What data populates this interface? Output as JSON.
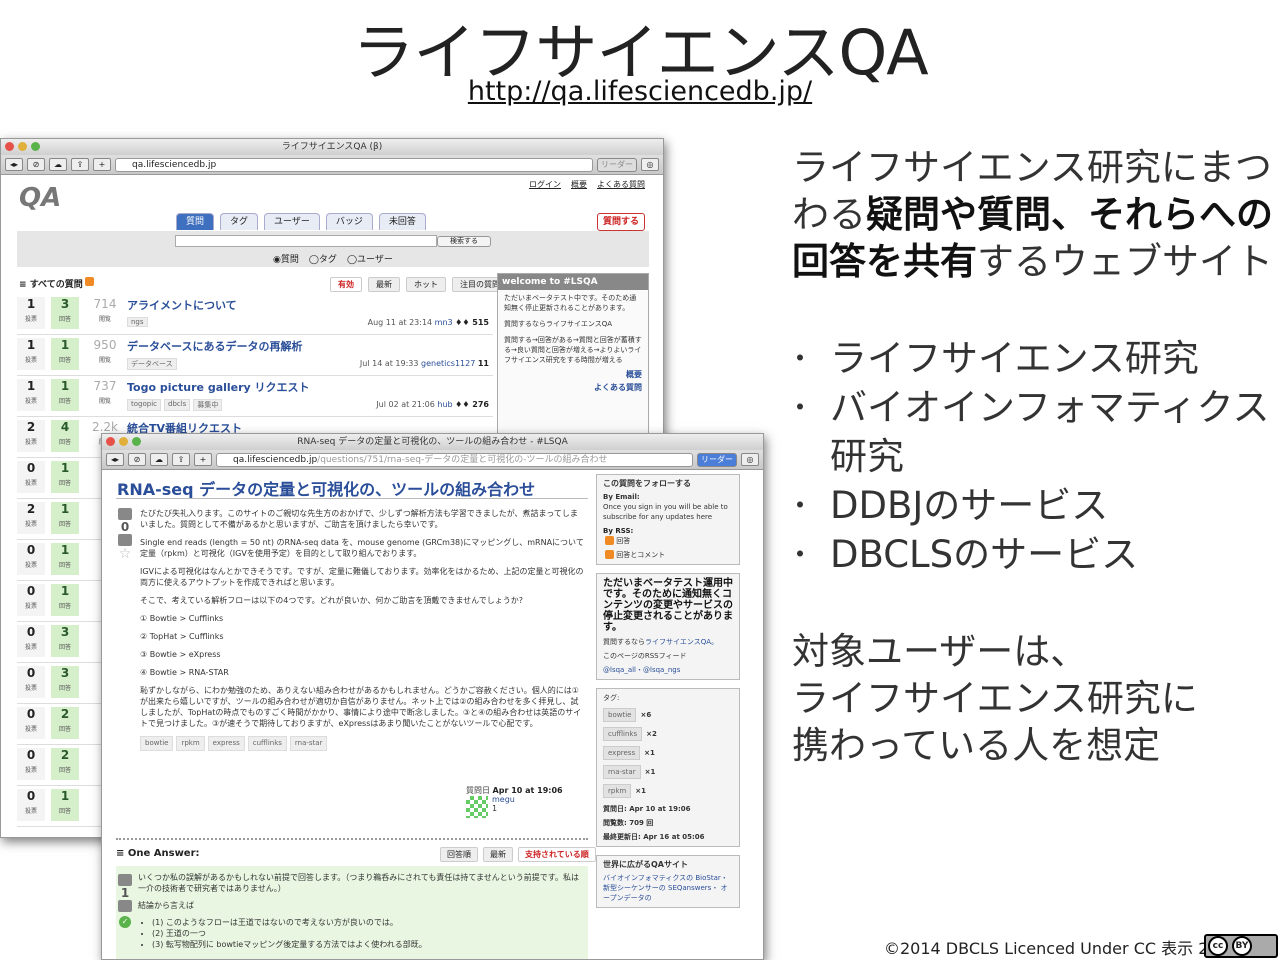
{
  "slide": {
    "title": "ライフサイエンスQA",
    "url": "http://qa.lifesciencedb.jp/",
    "desc_line1": "ライフサイエンス研究にまつ",
    "desc_line2a": "わる",
    "desc_line2b": "疑問や質問、それらへの",
    "desc_line3a": "回答を共有",
    "desc_line3b": "するウェブサイト",
    "bullets": [
      "ライフサイエンス研究",
      "バイオインフォマティクス",
      "研究",
      "DDBJのサービス",
      "DBCLSのサービス"
    ],
    "target_line1": "対象ユーザーは、",
    "target_line2": "ライフサイエンス研究に",
    "target_line3": "携わっている人を想定",
    "footer": "©2014 DBCLS Licenced Under CC 表示 2.1",
    "cc_badge": "cc",
    "by_badge": "BY"
  },
  "window1": {
    "title": "ライフサイエンスQA (β)",
    "address": "qa.lifesciencedb.jp",
    "reader": "リーダー",
    "top_links": [
      "ログイン",
      "概要",
      "よくある質問"
    ],
    "logo": "QA",
    "tabs": [
      "質問",
      "タグ",
      "ユーザー",
      "バッジ",
      "未回答"
    ],
    "ask_button": "質問する",
    "search_button": "検索する",
    "radios": [
      "◉質問",
      "◯タグ",
      "◯ユーザー"
    ],
    "all_questions": "すべての質問",
    "sort": [
      "有効",
      "最新",
      "ホット",
      "注目の質問"
    ],
    "vote_label": "投票",
    "answer_label": "回答",
    "view_label": "閲覧",
    "questions": [
      {
        "votes": "1",
        "answers": "3",
        "views": "714",
        "title": "アライメントについて",
        "tags": [
          "ngs"
        ],
        "meta": "Aug 11 at 23:14",
        "user": "mn3",
        "rep": "♦♦ 515"
      },
      {
        "votes": "1",
        "answers": "1",
        "views": "950",
        "title": "データベースにあるデータの再解析",
        "tags": [
          "データベース"
        ],
        "meta": "Jul 14 at 19:33",
        "user": "genetics1127",
        "rep": "11"
      },
      {
        "votes": "1",
        "answers": "1",
        "views": "737",
        "title": "Togo picture gallery リクエスト",
        "tags": [
          "togopic",
          "dbcls",
          "募集中"
        ],
        "meta": "Jul 02 at 21:06",
        "user": "hub",
        "rep": "♦♦ 276"
      },
      {
        "votes": "2",
        "answers": "4",
        "views": "2.2k",
        "title": "統合TV番組リクエスト",
        "tags": [],
        "meta": "",
        "user": "",
        "rep": ""
      },
      {
        "votes": "0",
        "answers": "1",
        "views": "",
        "title": "",
        "tags": [],
        "meta": "",
        "user": "",
        "rep": ""
      },
      {
        "votes": "2",
        "answers": "1",
        "views": "",
        "title": "",
        "tags": [],
        "meta": "",
        "user": "",
        "rep": ""
      },
      {
        "votes": "0",
        "answers": "1",
        "views": "",
        "title": "",
        "tags": [],
        "meta": "",
        "user": "",
        "rep": ""
      },
      {
        "votes": "0",
        "answers": "1",
        "views": "",
        "title": "",
        "tags": [],
        "meta": "",
        "user": "",
        "rep": ""
      },
      {
        "votes": "0",
        "answers": "3",
        "views": "",
        "title": "",
        "tags": [],
        "meta": "",
        "user": "",
        "rep": ""
      },
      {
        "votes": "0",
        "answers": "3",
        "views": "",
        "title": "",
        "tags": [],
        "meta": "",
        "user": "",
        "rep": ""
      },
      {
        "votes": "0",
        "answers": "2",
        "views": "",
        "title": "",
        "tags": [],
        "meta": "",
        "user": "",
        "rep": ""
      },
      {
        "votes": "0",
        "answers": "2",
        "views": "",
        "title": "",
        "tags": [],
        "meta": "",
        "user": "",
        "rep": ""
      },
      {
        "votes": "0",
        "answers": "1",
        "views": "",
        "title": "",
        "tags": [],
        "meta": "",
        "user": "",
        "rep": ""
      }
    ],
    "welcome_title": "welcome to #LSQA",
    "welcome_p1": "ただいまベータテスト中です。そのため通知無く停止更新されることがあります。",
    "welcome_p2": "質問するならライフサイエンスQA",
    "welcome_p3": "質問する→回答がある→質問と回答が蓄積する→良い質問と回答が増える→よりよいライフサイエンス研究をする時間が増える",
    "welcome_link1": "概要",
    "welcome_link2": "よくある質問"
  },
  "window2": {
    "title": "RNA-seq データの定量と可視化の、ツールの組み合わせ - #LSQA",
    "address_host": "qa.lifesciencedb.jp",
    "address_path": "/questions/751/rna-seq-データの定量と可視化の-ツールの組み合わせ",
    "reader": "リーダー",
    "question_title": "RNA-seq データの定量と可視化の、ツールの組み合わせ",
    "q_votes": "0",
    "p1": "たびたび失礼入ります。このサイトのご親切な先生方のおかげで、少しずつ解析方法も学習できましたが、煮詰まってしまいました。質問として不備があるかと思いますが、ご助言を頂けましたら幸いです。",
    "p2": "Single end reads (length = 50 nt) のRNA-seq data を、mouse genome (GRCm38)にマッピングし、mRNAについて定量（rpkm）と可視化（IGVを使用予定）を目的として取り組んでおります。",
    "p3": "IGVによる可視化はなんとかできそうです。ですが、定量に難儀しております。効率化をはかるため、上記の定量と可視化の両方に使えるアウトプットを作成できればと思います。",
    "p4": "そこで、考えている解析フローは以下の4つです。どれが良いか、何かご助言を頂戴できませんでしょうか?",
    "flows": [
      "① Bowtie > Cufflinks",
      "② TopHat > Cufflinks",
      "③ Bowtie > eXpress",
      "④ Bowtie > RNA-STAR"
    ],
    "p5": "恥ずかしながら、にわか勉強のため、ありえない組み合わせがあるかもしれません。どうかご容赦ください。個人的には①が出来たら嬉しいですが、ツールの組み合わせが適切か自信がありません。ネット上では②の組み合わせを多く拝見し、試しましたが、TopHatの時点でものすごく時間がかかり、事情により途中で断念しました。③と④の組み合わせは英語のサイトで見つけました。③が速そうで期待しておりますが、eXpressはあまり聞いたことがないツールで心配です。",
    "tags": [
      "bowtie",
      "rpkm",
      "express",
      "cufflinks",
      "rna-star"
    ],
    "asked_label": "質問日",
    "asked_date": "Apr 10 at 19:06",
    "asker": "megu",
    "asker_rep": "1",
    "one_answer": "One Answer:",
    "answer_sort": [
      "回答順",
      "最新",
      "支持されている順"
    ],
    "a_votes": "1",
    "a_p1": "いくつか私の誤解があるかもしれない前提で回答します。（つまり鵜呑みにされても責任は持てませんという前提です。私は一介の技術者で研究者ではありません。）",
    "a_p2": "結論から言えば",
    "a_items": [
      "(1) このようなフローは王道ではないので考えない方が良いのでは。",
      "(2) 王道の一つ",
      "(3) 転写物配列に bowtieマッピング後定量する方法ではよく使われる部既。"
    ],
    "follow_title": "この質問をフォローする",
    "by_email": "By Email:",
    "email_text": "Once you sign in you will be able to subscribe for any updates here",
    "by_rss": "By RSS:",
    "rss1": "回答",
    "rss2": "回答とコメント",
    "beta_notice": "ただいまベータテスト運用中です。そのために通知無くコンテンツの変更やサービスの停止変更されることがあります。",
    "ask_text": "質問するなら",
    "ask_link": "ライフサイエンスQA。",
    "rss_feed": "このページのRSSフィード",
    "twitter": "@lsqa_all・@lsqa_ngs",
    "tags_title": "タグ:",
    "tag_counts": [
      {
        "tag": "bowtie",
        "n": "×6"
      },
      {
        "tag": "cufflinks",
        "n": "×2"
      },
      {
        "tag": "express",
        "n": "×1"
      },
      {
        "tag": "rna-star",
        "n": "×1"
      },
      {
        "tag": "rpkm",
        "n": "×1"
      }
    ],
    "stat_asked": "質問日: Apr 10 at 19:06",
    "stat_views": "閲覧数: 709 回",
    "stat_updated": "最終更新日: Apr 16 at 05:06",
    "world_title": "世界に広がるQAサイト",
    "world_text": "バイオインフォマティクスの BioStar・ 新型シーケンサーの SEQanswers・ オープンデータの"
  }
}
